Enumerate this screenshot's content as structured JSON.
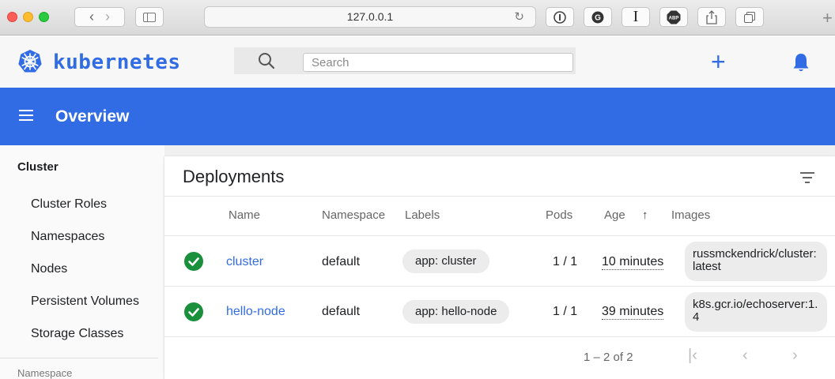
{
  "browser": {
    "url": "127.0.0.1"
  },
  "header": {
    "brand": "kubernetes",
    "search_placeholder": "Search"
  },
  "toolbar": {
    "title": "Overview"
  },
  "sidebar": {
    "section": "Cluster",
    "items": [
      {
        "label": "Cluster Roles"
      },
      {
        "label": "Namespaces"
      },
      {
        "label": "Nodes"
      },
      {
        "label": "Persistent Volumes"
      },
      {
        "label": "Storage Classes"
      }
    ],
    "next_section": "Namespace"
  },
  "deployments": {
    "title": "Deployments",
    "columns": {
      "name": "Name",
      "namespace": "Namespace",
      "labels": "Labels",
      "pods": "Pods",
      "age": "Age",
      "images": "Images"
    },
    "sort_indicator": "↑",
    "rows": [
      {
        "status": "ok",
        "name": "cluster",
        "namespace": "default",
        "label": "app: cluster",
        "pods": "1 / 1",
        "age": "10 minutes",
        "image": "russmckendrick/cluster:latest"
      },
      {
        "status": "ok",
        "name": "hello-node",
        "namespace": "default",
        "label": "app: hello-node",
        "pods": "1 / 1",
        "age": "39 minutes",
        "image": "k8s.gcr.io/echoserver:1.4"
      }
    ],
    "pagination": "1 – 2 of 2"
  },
  "colors": {
    "brand_blue": "#326ce5",
    "success_green": "#1a8f3c"
  }
}
